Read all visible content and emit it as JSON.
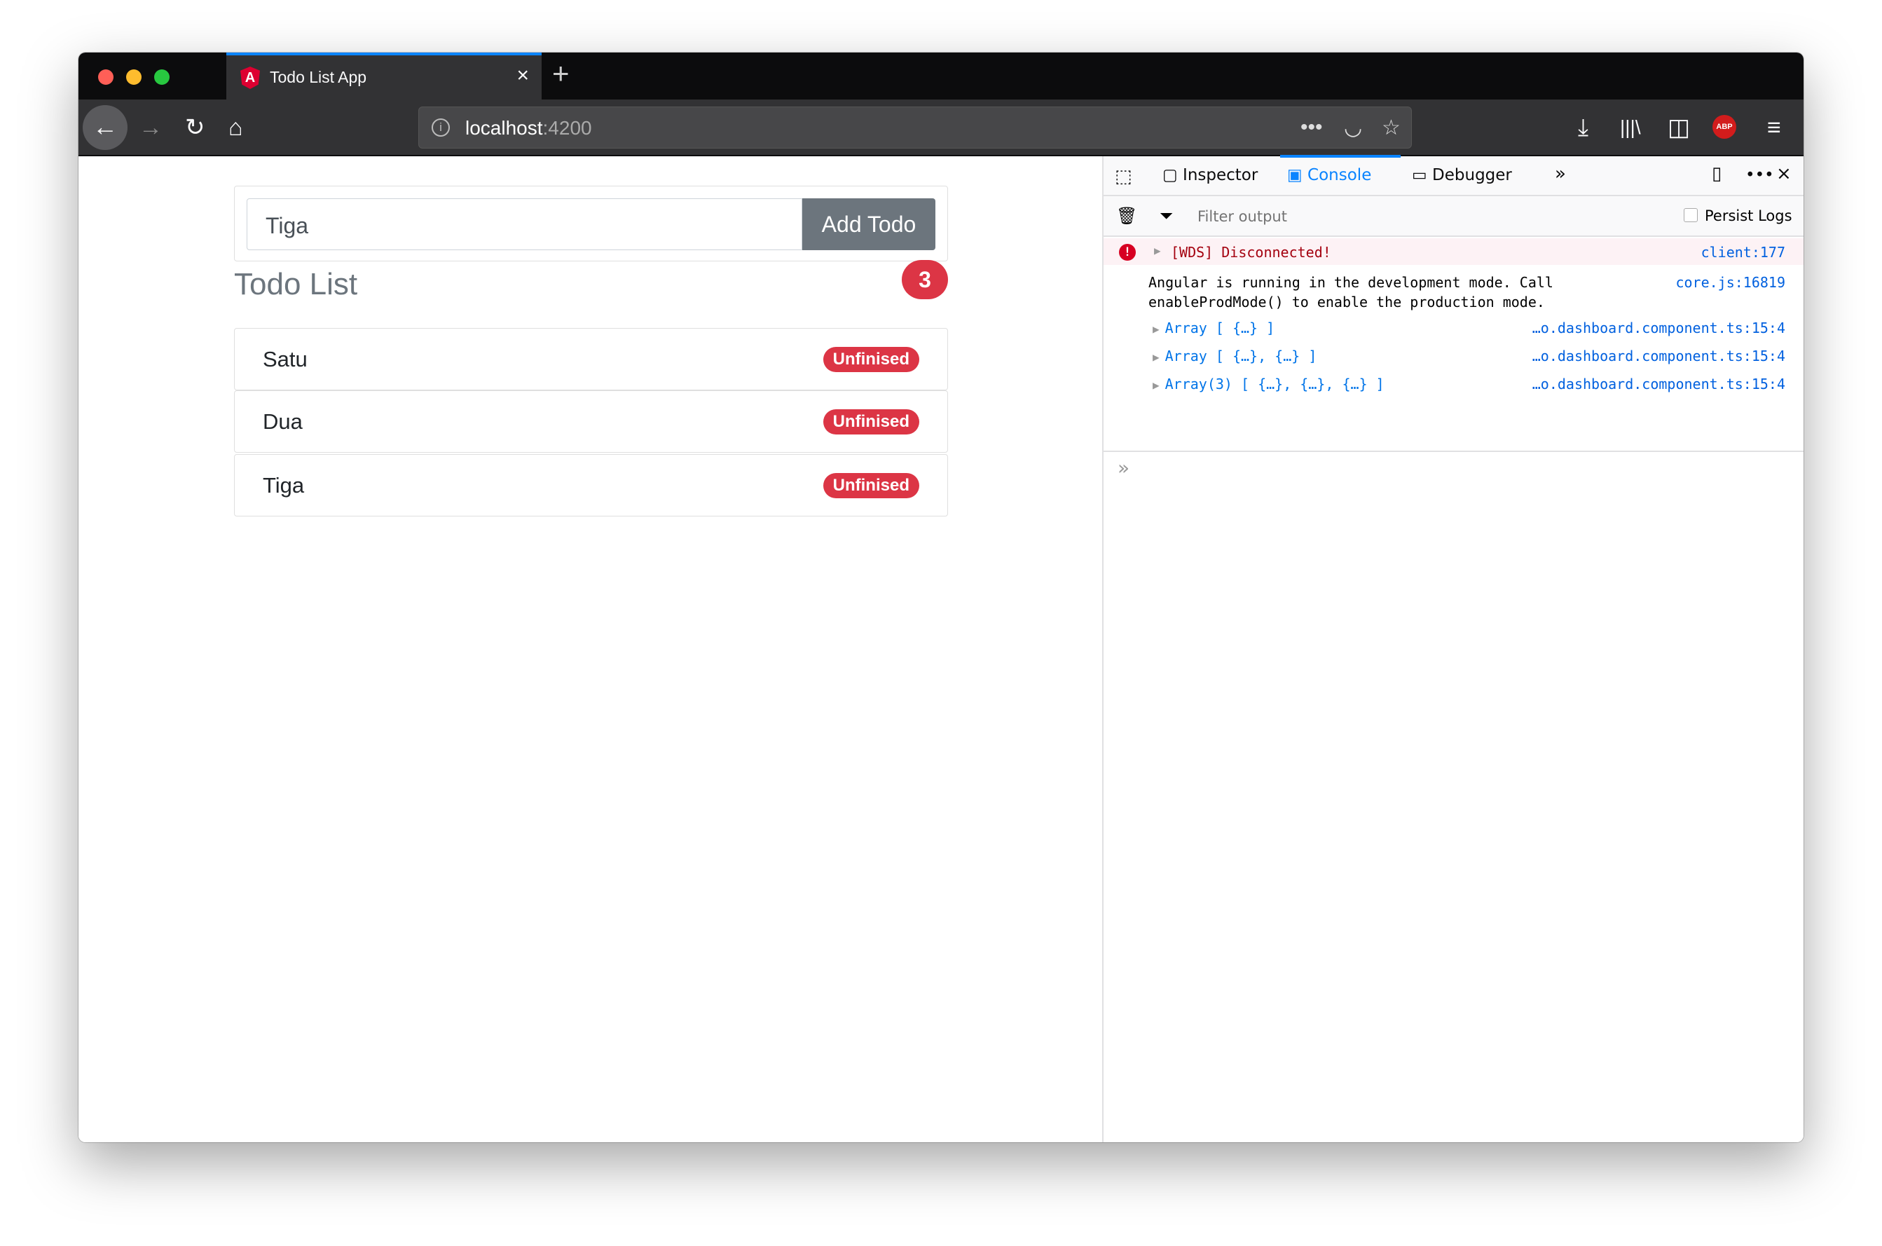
{
  "browser": {
    "tab_title": "Todo List App",
    "url_host": "localhost",
    "url_port": ":4200"
  },
  "app": {
    "input_value": "Tiga",
    "add_button": "Add Todo",
    "heading": "Todo List",
    "count": "3",
    "todos": [
      {
        "title": "Satu",
        "status": "Unfinised"
      },
      {
        "title": "Dua",
        "status": "Unfinised"
      },
      {
        "title": "Tiga",
        "status": "Unfinised"
      }
    ]
  },
  "devtools": {
    "tabs": [
      "Inspector",
      "Console",
      "Debugger"
    ],
    "active_tab": "Console",
    "filter_placeholder": "Filter output",
    "persist_logs": "Persist Logs",
    "logs": [
      {
        "text": "[WDS] Disconnected!",
        "source": "client:177",
        "level": "error"
      },
      {
        "text": "Angular is running in the development mode. Call",
        "text2": "enableProdMode() to enable the production mode.",
        "source": "core.js:16819"
      },
      {
        "text": "Array [ {…} ]",
        "source": "…o.dashboard.component.ts:15:4"
      },
      {
        "text": "Array [ {…}, {…} ]",
        "source": "…o.dashboard.component.ts:15:4"
      },
      {
        "text": "Array(3) [ {…}, {…}, {…} ]",
        "source": "…o.dashboard.component.ts:15:4"
      }
    ]
  },
  "colors": {
    "accent": "#0a84ff",
    "danger": "#dc3545",
    "secondary": "#6c757d"
  }
}
